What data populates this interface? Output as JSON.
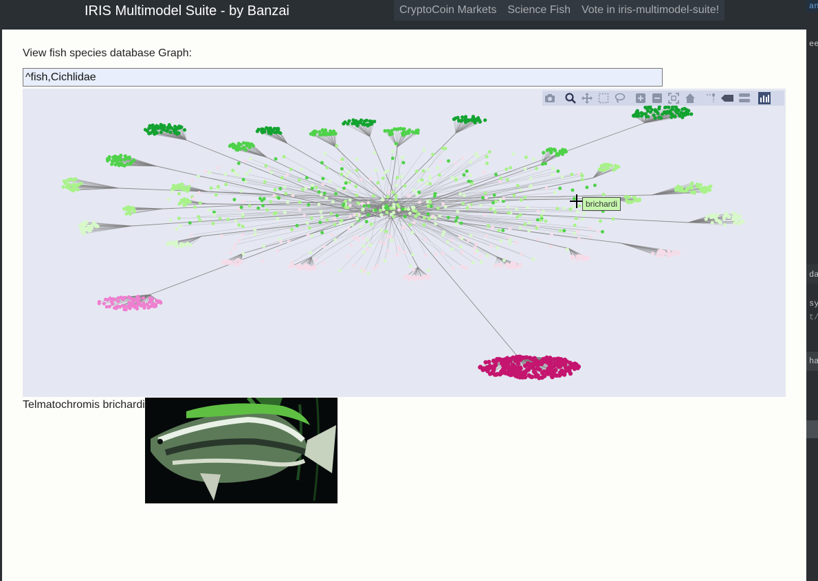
{
  "navbar": {
    "brand": "IRIS Multimodel Suite - by Banzai",
    "links": [
      "CryptoCoin Markets",
      "Science Fish",
      "Vote in iris-multimodel-suite!"
    ]
  },
  "main": {
    "view_label": "View fish species database Graph:",
    "query_value": "^fish,Cichlidae",
    "hover_tooltip": "brichardi",
    "species_caption": "Telmatochromis brichardi",
    "species_image_alt": "Telmatochromis brichardi"
  },
  "modebar": {
    "buttons": [
      "camera-icon",
      "zoom-icon",
      "pan-icon",
      "box-select-icon",
      "lasso-select-icon",
      "zoom-in-icon",
      "zoom-out-icon",
      "autoscale-icon",
      "reset-axes-icon",
      "spike-lines-icon",
      "hover-closest-icon",
      "hover-compare-icon",
      "plotly-logo-icon"
    ]
  },
  "graph_colors": {
    "edge": "#7f7f7f",
    "dark_green": "#13a330",
    "mid_green": "#4fd24a",
    "light_green": "#a9f28a",
    "pale_green": "#d7f8c8",
    "pale_pink": "#f6dce8",
    "pink": "#ef7fd0",
    "magenta": "#c4156f"
  },
  "ide_strip": {
    "fragments": [
      "an",
      "ee",
      "da",
      "sy",
      "t/",
      "ha"
    ]
  }
}
